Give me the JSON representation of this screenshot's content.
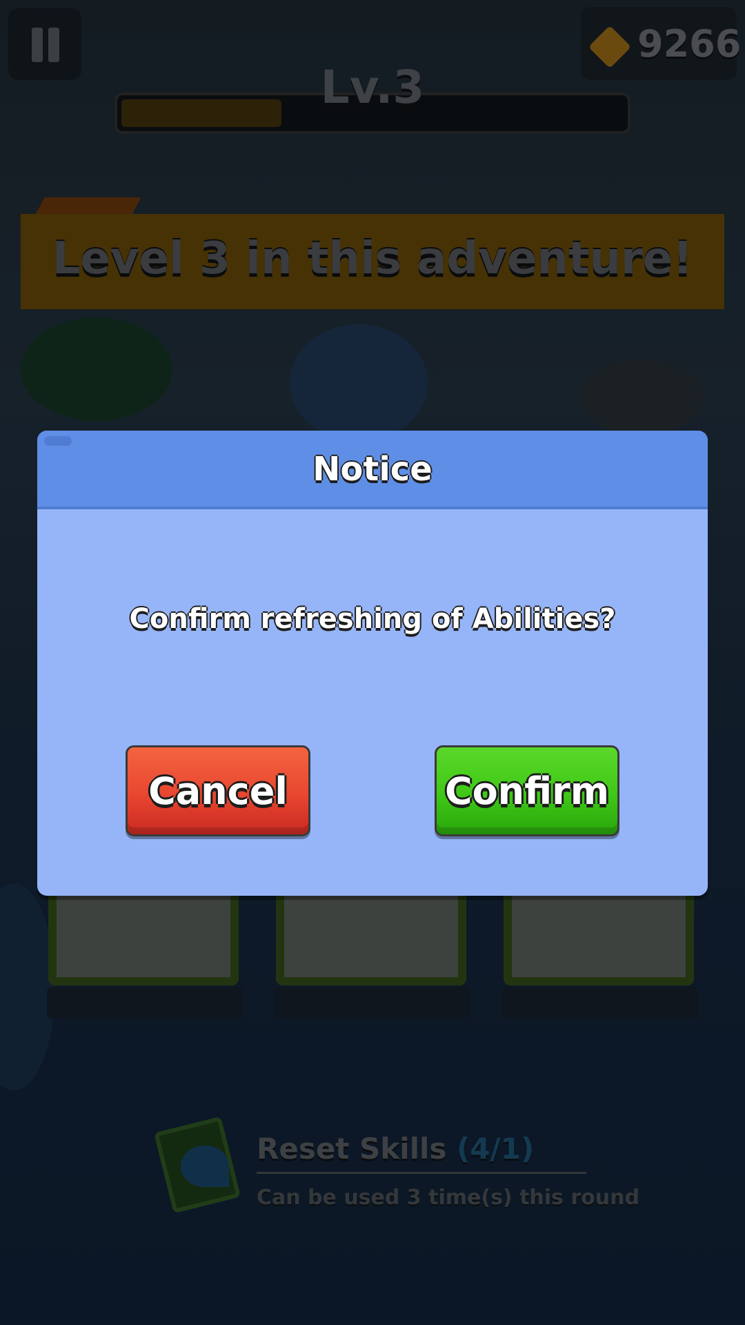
{
  "hud": {
    "gems": "9266",
    "level_label": "Lv.3",
    "xp_progress": 0.33
  },
  "banner": {
    "text": "Level 3 in this adventure!"
  },
  "reset": {
    "title": "Reset Skills",
    "count": "(4/1)",
    "subtitle": "Can be used 3 time(s) this round"
  },
  "dialog": {
    "title": "Notice",
    "message": "Confirm refreshing of Abilities?",
    "cancel_label": "Cancel",
    "confirm_label": "Confirm"
  },
  "colors": {
    "dialog_body": "#96b5f8",
    "dialog_header": "#5f8ee6",
    "cancel": "#e84630",
    "confirm": "#3fc816",
    "overlay": "#0c1520"
  },
  "icons": [
    "pause-icon",
    "gem-icon",
    "reset-skills-icon"
  ]
}
